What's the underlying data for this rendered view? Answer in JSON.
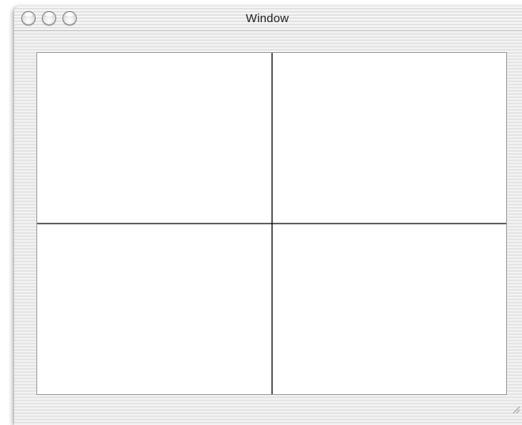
{
  "window": {
    "title": "Window",
    "buttons": {
      "close": "close-button",
      "minimize": "minimize-button",
      "zoom": "zoom-button"
    }
  },
  "content": {
    "background": "#ffffff",
    "line_color": "#000000"
  }
}
